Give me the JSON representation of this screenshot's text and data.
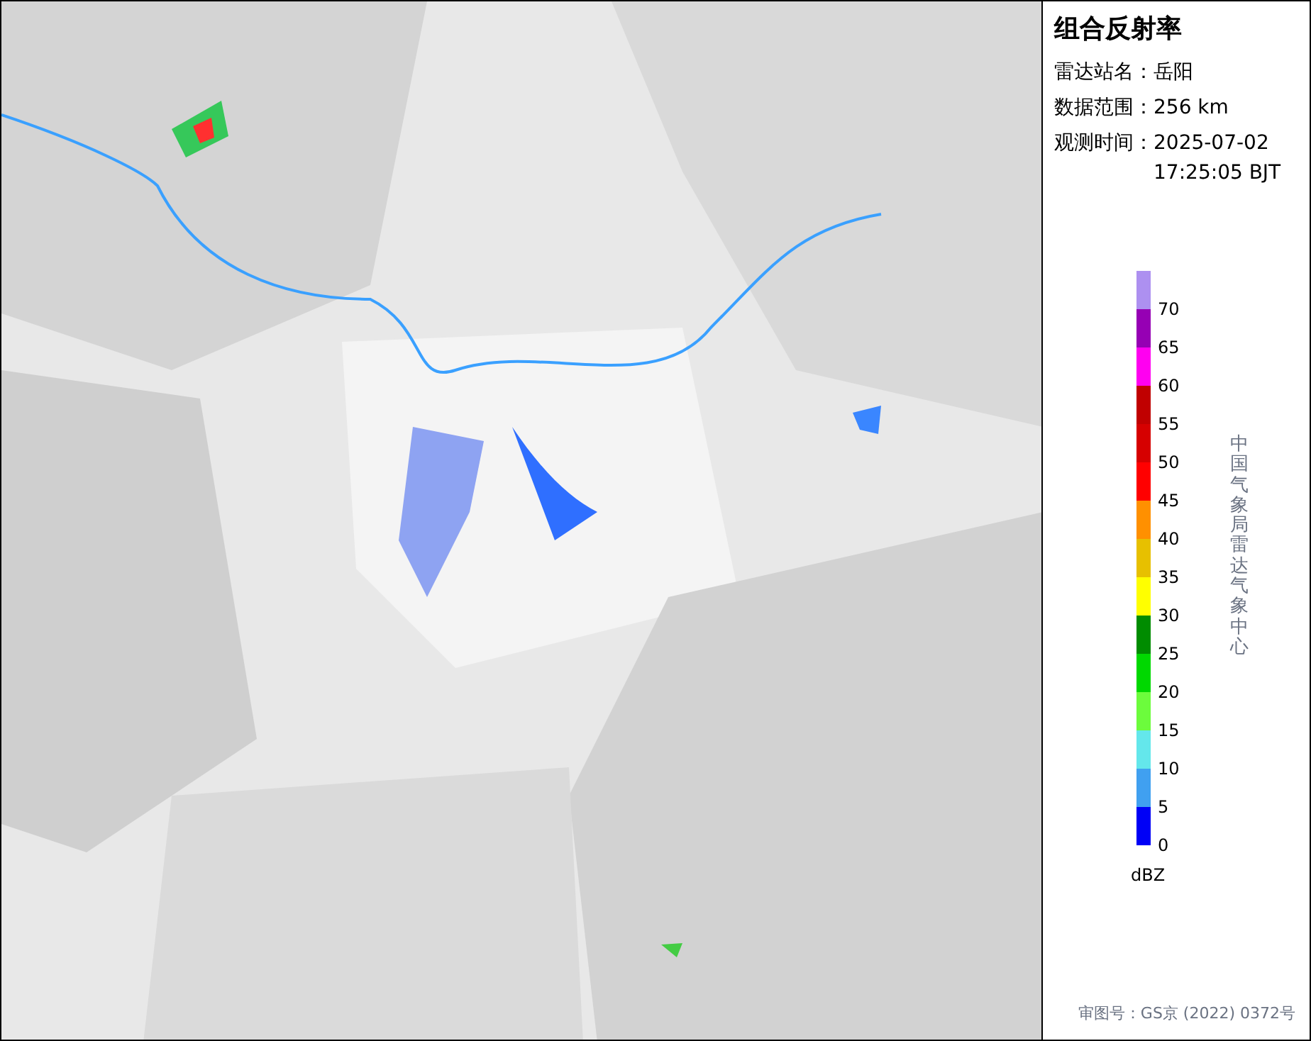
{
  "panel": {
    "title": "组合反射率",
    "fields": [
      {
        "label": "雷达站名：",
        "value": "岳阳"
      },
      {
        "label": "数据范围：",
        "value": "256 km"
      },
      {
        "label": "观测时间：",
        "value": "2025-07-02 17:25:05 BJT"
      }
    ],
    "legend": {
      "unit": "dBZ",
      "bins": [
        {
          "color": "#ad90f0",
          "label": "70"
        },
        {
          "color": "#9600b4",
          "label": "65"
        },
        {
          "color": "#ff00f0",
          "label": "60"
        },
        {
          "color": "#c00000",
          "label": "55"
        },
        {
          "color": "#d60000",
          "label": "50"
        },
        {
          "color": "#ff0000",
          "label": "45"
        },
        {
          "color": "#ff9000",
          "label": "40"
        },
        {
          "color": "#e7c000",
          "label": "35"
        },
        {
          "color": "#ffff00",
          "label": "30"
        },
        {
          "color": "#008c00",
          "label": "25"
        },
        {
          "color": "#00d800",
          "label": "20"
        },
        {
          "color": "#6cfc3c",
          "label": "15"
        },
        {
          "color": "#64e7eb",
          "label": "10"
        },
        {
          "color": "#40a0f0",
          "label": "5"
        },
        {
          "color": "#0000f6",
          "label": "0"
        }
      ]
    },
    "credit": "中国气象局雷达气象中心",
    "approval": "审图号：GS京 (2022) 0372号"
  }
}
